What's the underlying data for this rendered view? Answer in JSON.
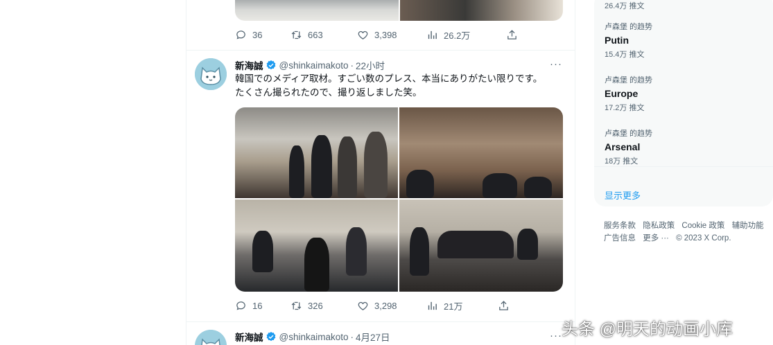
{
  "tweet_prev": {
    "reply_count": "36",
    "retweet_count": "663",
    "like_count": "3,398",
    "view_count": "26.2万"
  },
  "tweet_main": {
    "name": "新海誠",
    "handle": "@shinkaimakoto",
    "dot": "·",
    "time": "22小时",
    "more": "···",
    "text_line1": "韓国でのメディア取材。すごい数のプレス、本当にありがたい限りです。",
    "text_line2": "たくさん撮られたので、撮り返しました笑。",
    "reply_count": "16",
    "retweet_count": "326",
    "like_count": "3,298",
    "view_count": "21万"
  },
  "tweet_next": {
    "name": "新海誠",
    "handle": "@shinkaimakoto",
    "dot": "·",
    "time": "4月27日",
    "more": "···"
  },
  "sidebar": {
    "top_count": "26.4万 推文",
    "trends": [
      {
        "context": "卢森堡 的趋势",
        "topic": "Putin",
        "count": "15.4万 推文"
      },
      {
        "context": "卢森堡 的趋势",
        "topic": "Europe",
        "count": "17.2万 推文"
      },
      {
        "context": "卢森堡 的趋势",
        "topic": "Arsenal",
        "count": "18万 推文"
      }
    ],
    "show_more": "显示更多"
  },
  "footer": {
    "terms": "服务条款",
    "privacy": "隐私政策",
    "cookie": "Cookie 政策",
    "accessibility": "辅助功能",
    "ads": "广告信息",
    "more": "更多 ···",
    "copyright": "© 2023 X Corp."
  },
  "watermark": "头条 @明天的动画小库",
  "colors": {
    "accent": "#1d9bf0",
    "text_secondary": "#536471",
    "verified": "#1d9bf0"
  }
}
